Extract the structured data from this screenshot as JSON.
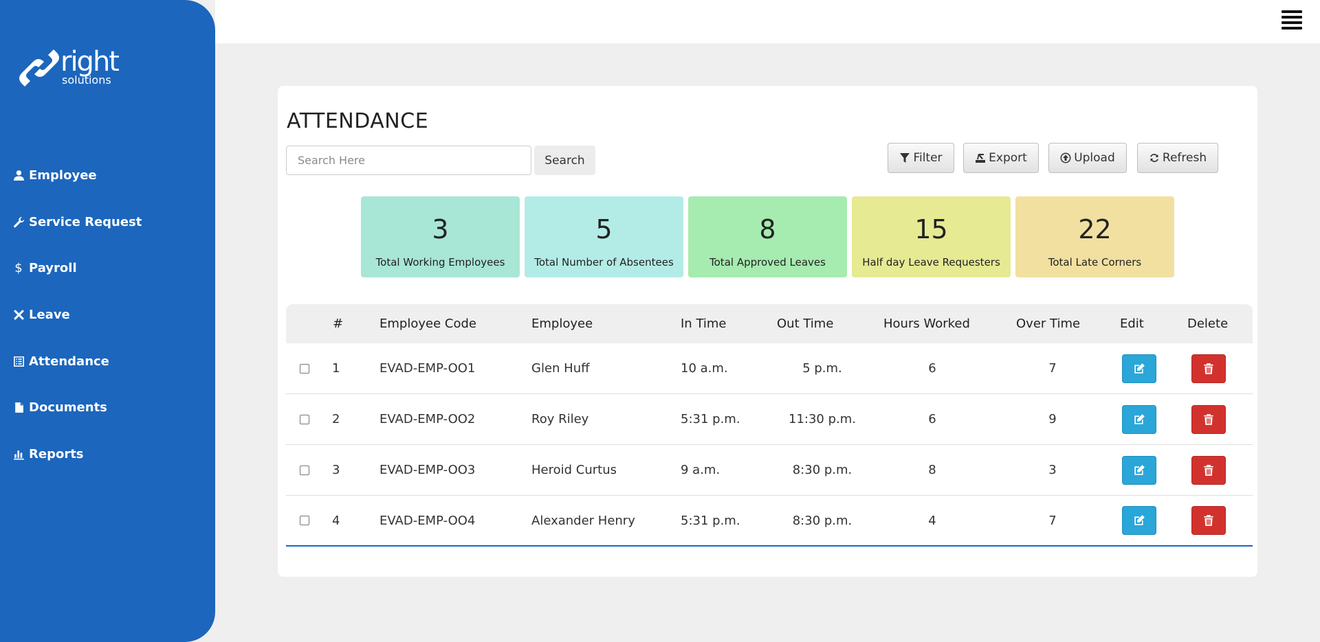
{
  "logo": {
    "word": "right",
    "sub": "solutions"
  },
  "sidebar": {
    "items": [
      {
        "label": "Employee",
        "icon": "user-icon"
      },
      {
        "label": "Service Request",
        "icon": "wrench-icon"
      },
      {
        "label": "Payroll",
        "icon": "dollar-icon"
      },
      {
        "label": "Leave",
        "icon": "close-icon"
      },
      {
        "label": "Attendance",
        "icon": "list-icon"
      },
      {
        "label": "Documents",
        "icon": "file-icon"
      },
      {
        "label": "Reports",
        "icon": "bar-chart-icon"
      }
    ]
  },
  "page": {
    "title": "ATTENDANCE"
  },
  "search": {
    "placeholder": "Search Here",
    "button": "Search"
  },
  "toolbar": {
    "filter": "Filter",
    "export": "Export",
    "upload": "Upload",
    "refresh": "Refresh"
  },
  "stats": [
    {
      "value": "3",
      "label": "Total Working Employees",
      "color": "#a8e6d6"
    },
    {
      "value": "5",
      "label": "Total Number of Absentees",
      "color": "#b3ece6"
    },
    {
      "value": "8",
      "label": "Total Approved Leaves",
      "color": "#a6ebaf"
    },
    {
      "value": "15",
      "label": "Half day Leave Requesters",
      "color": "#e6ea93"
    },
    {
      "value": "22",
      "label": "Total Late Corners",
      "color": "#f1e0a0"
    }
  ],
  "table": {
    "headers": [
      "#",
      "Employee Code",
      "Employee",
      "In Time",
      "Out Time",
      "Hours Worked",
      "Over Time",
      "Edit",
      "Delete"
    ],
    "rows": [
      {
        "num": "1",
        "code": "EVAD-EMP-OO1",
        "name": "Glen Huff",
        "in": "10 a.m.",
        "out": "5 p.m.",
        "hours": "6",
        "ot": "7"
      },
      {
        "num": "2",
        "code": "EVAD-EMP-OO2",
        "name": "Roy Riley",
        "in": "5:31 p.m.",
        "out": "11:30 p.m.",
        "hours": "6",
        "ot": "9"
      },
      {
        "num": "3",
        "code": "EVAD-EMP-OO3",
        "name": "Heroid Curtus",
        "in": "9 a.m.",
        "out": "8:30 p.m.",
        "hours": "8",
        "ot": "3"
      },
      {
        "num": "4",
        "code": "EVAD-EMP-OO4",
        "name": "Alexander Henry",
        "in": "5:31 p.m.",
        "out": "8:30 p.m.",
        "hours": "4",
        "ot": "7"
      }
    ]
  },
  "colors": {
    "sidebar": "#1c66bd",
    "edit": "#2aa6d8",
    "delete": "#d2322d"
  }
}
